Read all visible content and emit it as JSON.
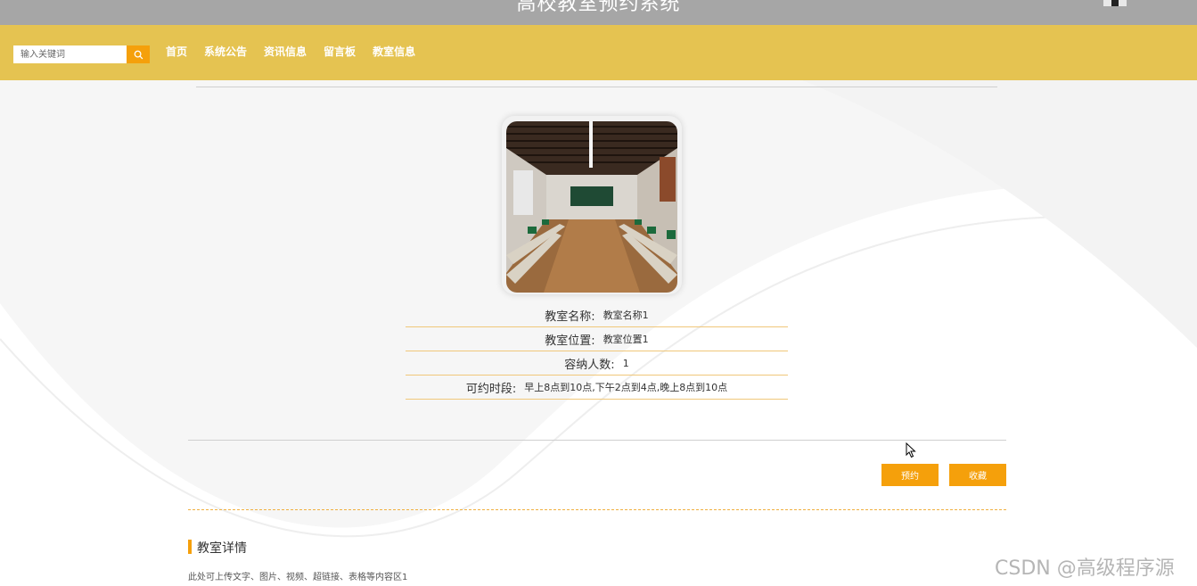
{
  "header": {
    "site_title": "高校教室预约系统"
  },
  "nav": {
    "search_placeholder": "输入关键词",
    "items": [
      {
        "label": "首页"
      },
      {
        "label": "系统公告"
      },
      {
        "label": "资讯信息"
      },
      {
        "label": "留言板"
      },
      {
        "label": "教室信息"
      }
    ]
  },
  "classroom": {
    "fields": [
      {
        "label": "教室名称:",
        "value": "教室名称1"
      },
      {
        "label": "教室位置:",
        "value": "教室位置1"
      },
      {
        "label": "容纳人数:",
        "value": "1"
      },
      {
        "label": "可约时段:",
        "value": "早上8点到10点,下午2点到4点,晚上8点到10点"
      }
    ]
  },
  "actions": {
    "book_label": "预约",
    "favorite_label": "收藏"
  },
  "detail": {
    "title": "教室详情",
    "text": "此处可上传文字、图片、视频、超链接、表格等内容区1"
  },
  "watermark": "CSDN @高级程序源",
  "colors": {
    "nav_bg": "#e5c351",
    "accent": "#f5a00b",
    "topbar_bg": "#a6a6a6"
  }
}
